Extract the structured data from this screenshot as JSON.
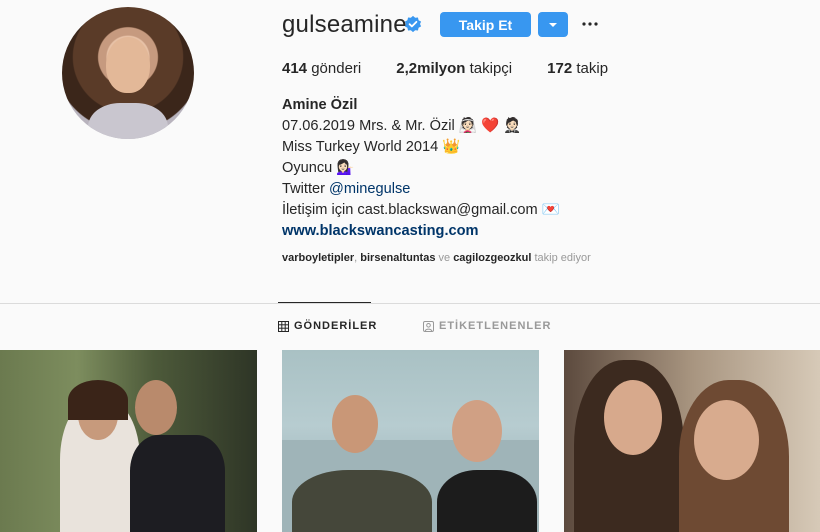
{
  "profile": {
    "username": "gulseamine",
    "follow_label": "Takip Et"
  },
  "stats": {
    "posts_count": "414",
    "posts_label": "gönderi",
    "followers_count": "2,2milyon",
    "followers_label": "takipçi",
    "following_count": "172",
    "following_label": "takip"
  },
  "bio": {
    "name": "Amine Özil",
    "line1": "07.06.2019 Mrs. & Mr. Özil 👰🏻 ❤️ 🤵🏻",
    "line2": "Miss Turkey World 2014 👑",
    "line3": "Oyuncu 💁🏻‍♀️",
    "line4_prefix": "Twitter ",
    "line4_link": "@minegulse",
    "line5": "İletişim için cast.blackswan@gmail.com 💌",
    "website": "www.blackswancasting.com"
  },
  "followed_by": {
    "user1": "varboyletipler",
    "sep1": ", ",
    "user2": "birsenaltuntas",
    "sep2": " ve ",
    "user3": "cagilozgeozkul",
    "suffix": " takip ediyor"
  },
  "tabs": {
    "posts": "GÖNDERİLER",
    "tagged": "ETİKETLENENLER"
  },
  "colors": {
    "accent": "#3897f0",
    "link": "#003569",
    "verified": "#3897f0"
  },
  "icons": {
    "verified": "verified-badge-icon",
    "dropdown": "chevron-down-icon",
    "more": "more-horizontal-icon",
    "posts_tab": "grid-icon",
    "tagged_tab": "tagged-person-icon"
  }
}
